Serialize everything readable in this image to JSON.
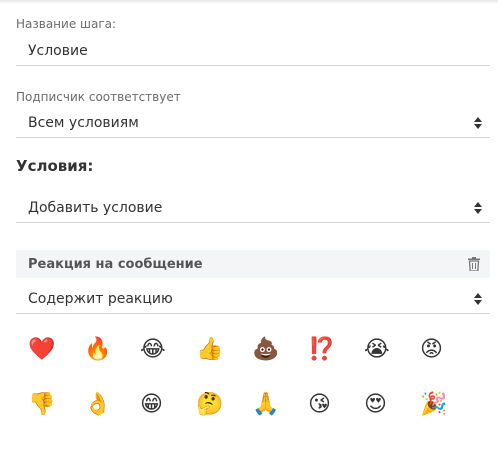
{
  "step": {
    "label": "Название шага:",
    "value": "Условие"
  },
  "subscriber": {
    "label": "Подписчик соответствует",
    "selected": "Всем условиям"
  },
  "conditions": {
    "heading": "Условия:",
    "add_selected": "Добавить условие"
  },
  "reaction_condition": {
    "title": "Реакция на сообщение",
    "operator_selected": "Содержит реакцию",
    "emojis_row1": [
      "❤️",
      "🔥",
      "😂",
      "👍",
      "💩",
      "⁉️",
      "😭",
      "😡"
    ],
    "emojis_row2": [
      "👎",
      "👌",
      "😁",
      "🤔",
      "🙏",
      "😘",
      "😍",
      "🎉"
    ]
  },
  "icons": {
    "select_arrows": "sort-icon",
    "delete": "trash-icon"
  }
}
